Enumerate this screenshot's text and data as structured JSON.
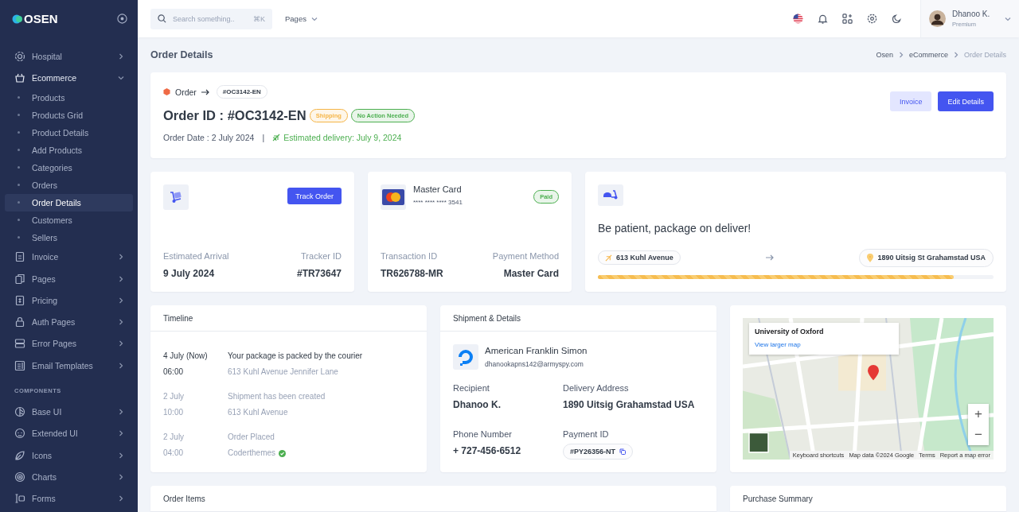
{
  "sidebar": {
    "logo": "OSEN",
    "items": [
      {
        "kind": "item",
        "label": "Hospital",
        "expanded": false
      },
      {
        "kind": "item",
        "label": "Ecommerce",
        "expanded": true,
        "children": [
          {
            "label": "Products",
            "selected": false
          },
          {
            "label": "Products Grid",
            "selected": false
          },
          {
            "label": "Product Details",
            "selected": false
          },
          {
            "label": "Add Products",
            "selected": false
          },
          {
            "label": "Categories",
            "selected": false
          },
          {
            "label": "Orders",
            "selected": false
          },
          {
            "label": "Order Details",
            "selected": true
          },
          {
            "label": "Customers",
            "selected": false
          },
          {
            "label": "Sellers",
            "selected": false
          }
        ]
      },
      {
        "kind": "item",
        "label": "Invoice",
        "expanded": false
      },
      {
        "kind": "item",
        "label": "Pages",
        "expanded": false
      },
      {
        "kind": "item",
        "label": "Pricing",
        "expanded": false
      },
      {
        "kind": "item",
        "label": "Auth Pages",
        "expanded": false
      },
      {
        "kind": "item",
        "label": "Error Pages",
        "expanded": false
      },
      {
        "kind": "item",
        "label": "Email Templates",
        "expanded": false
      },
      {
        "kind": "section",
        "label": "COMPONENTS"
      },
      {
        "kind": "item",
        "label": "Base UI",
        "expanded": false
      },
      {
        "kind": "item",
        "label": "Extended UI",
        "expanded": false
      },
      {
        "kind": "item",
        "label": "Icons",
        "expanded": false
      },
      {
        "kind": "item",
        "label": "Charts",
        "expanded": false
      },
      {
        "kind": "item",
        "label": "Forms",
        "expanded": false
      }
    ]
  },
  "topbar": {
    "search": {
      "placeholder": "Search something..",
      "shortcut": "⌘K"
    },
    "pages_menu": "Pages",
    "user": {
      "name": "Dhanoo K.",
      "role": "Premium"
    }
  },
  "page_title": "Order Details",
  "breadcrumb": [
    "Osen",
    "eCommerce",
    "Order Details"
  ],
  "order": {
    "crumb": "Order",
    "code": "#OC3142-EN",
    "title": "Order ID : #OC3142-EN",
    "badges": [
      {
        "label": "Shipping",
        "color": "#f5b547"
      },
      {
        "label": "No Action Needed",
        "color": "#4caf50"
      }
    ],
    "order_date": "Order Date : 2 July 2024",
    "separator": "|",
    "estimated_delivery": "Estimated delivery: July 9, 2024",
    "buttons": [
      {
        "label": "Invoice",
        "kind": "secondary"
      },
      {
        "label": "Edit Details",
        "kind": "primary"
      }
    ]
  },
  "tracking_card": {
    "button": "Track Order",
    "fields": [
      {
        "label": "Estimated Arrival",
        "value": "9 July 2024"
      },
      {
        "label": "Tracker ID",
        "value": "#TR73647"
      }
    ]
  },
  "payment_card": {
    "name": "Master Card",
    "number": "**** **** **** 3541",
    "status": "Paid",
    "fields": [
      {
        "label": "Transaction ID",
        "value": "TR626788-MR"
      },
      {
        "label": "Payment Method",
        "value": "Master Card"
      }
    ]
  },
  "delivery_card": {
    "message": "Be patient, package on deliver!",
    "from": "613 Kuhl Avenue",
    "to": "1890 Uitsig St Grahamstad USA",
    "level": 0.9
  },
  "timeline": {
    "title": "Timeline",
    "events": [
      {
        "date": "4 July (Now)",
        "time": "06:00",
        "title": "Your package is packed by the courier",
        "detail": "613 Kuhl Avenue Jennifer Lane",
        "current": true,
        "verified": false
      },
      {
        "date": "2 July",
        "time": "10:00",
        "title": "Shipment has been created",
        "detail": "613 Kuhl Avenue",
        "current": false,
        "verified": false
      },
      {
        "date": "2 July",
        "time": "04:00",
        "title": "Order Placed",
        "detail": "Coderthemes",
        "current": false,
        "verified": true
      }
    ]
  },
  "shipment": {
    "title": "Shipment & Details",
    "company": "American Franklin Simon",
    "email": "dhanookapns142@armyspy.com",
    "fields": [
      {
        "label": "Recipient",
        "value": "Dhanoo K.",
        "kind": "text"
      },
      {
        "label": "Delivery Address",
        "value": "1890 Uitsig Grahamstad USA",
        "kind": "text"
      },
      {
        "label": "Phone Number",
        "value": "+ 727-456-6512",
        "kind": "text"
      },
      {
        "label": "Payment ID",
        "value": "#PY26356-NT",
        "kind": "copy"
      }
    ]
  },
  "map": {
    "place": "University of Oxford",
    "link": "View larger map",
    "controls": [
      "+",
      "−"
    ],
    "footer": [
      "Keyboard shortcuts",
      "Map data ©2024 Google",
      "Terms",
      "Report a map error"
    ]
  },
  "bottom_cards": [
    "Order Items",
    "Purchase Summary"
  ]
}
